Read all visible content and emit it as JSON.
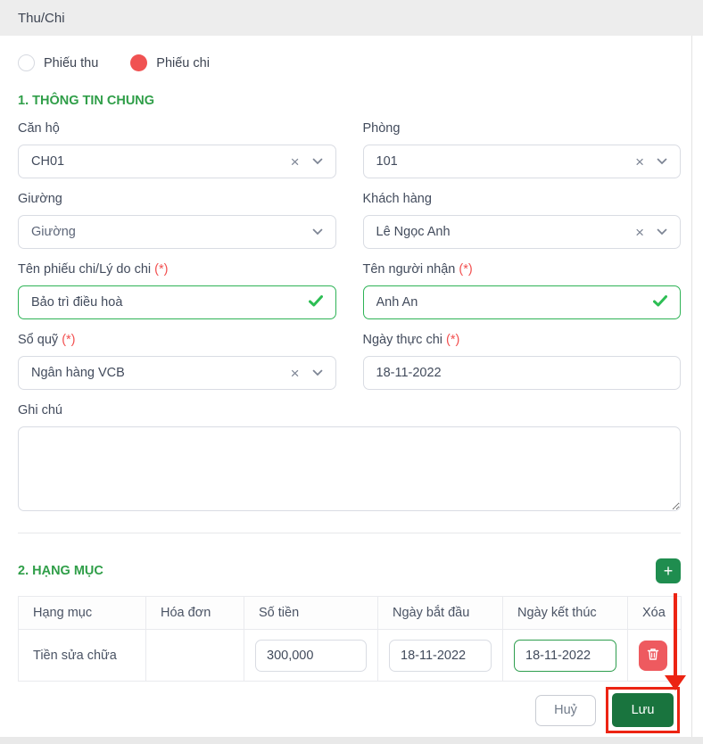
{
  "header": {
    "title": "Thu/Chi"
  },
  "radio_group": {
    "options": [
      {
        "label": "Phiếu thu",
        "checked": false
      },
      {
        "label": "Phiếu chi",
        "checked": true
      }
    ]
  },
  "sections": {
    "info_title": "1. THÔNG TIN CHUNG",
    "items_title": "2. HẠNG MỤC"
  },
  "fields": {
    "can_ho": {
      "label": "Căn hộ",
      "value": "CH01"
    },
    "phong": {
      "label": "Phòng",
      "value": "101"
    },
    "giuong": {
      "label": "Giường",
      "placeholder": "Giường"
    },
    "khach_hang": {
      "label": "Khách hàng",
      "value": "Lê Ngọc Anh"
    },
    "ten_phieu_chi": {
      "label": "Tên phiếu chi/Lý do chi",
      "required_mark": "(*)",
      "value": "Bảo trì điều hoà"
    },
    "ten_nguoi_nhan": {
      "label": "Tên người nhận",
      "required_mark": "(*)",
      "value": "Anh An"
    },
    "so_quy": {
      "label": "Sổ quỹ",
      "required_mark": "(*)",
      "value": "Ngân hàng VCB"
    },
    "ngay_thuc_chi": {
      "label": "Ngày thực chi",
      "required_mark": "(*)",
      "value": "18-11-2022"
    },
    "ghi_chu": {
      "label": "Ghi chú",
      "value": ""
    }
  },
  "table": {
    "headers": [
      "Hạng mục",
      "Hóa đơn",
      "Số tiền",
      "Ngày bắt đầu",
      "Ngày kết thúc",
      "Xóa"
    ],
    "rows": [
      {
        "hang_muc": "Tiền sửa chữa",
        "hoa_don": "",
        "so_tien": "300,000",
        "ngay_bat_dau": "18-11-2022",
        "ngay_ket_thuc": "18-11-2022"
      }
    ]
  },
  "footer": {
    "cancel_label": "Huỷ",
    "save_label": "Lưu"
  },
  "icons": {
    "plus": "+",
    "clear": "×"
  },
  "colors": {
    "accent_green": "#2f9e48",
    "save_green": "#19743e",
    "add_green": "#1f8d4f",
    "valid_green": "#2eb356",
    "radio_red": "#f05252",
    "trash_red": "#ee5a5f",
    "annotation_red": "#ec2413",
    "titlebar_gray": "#ededed"
  }
}
